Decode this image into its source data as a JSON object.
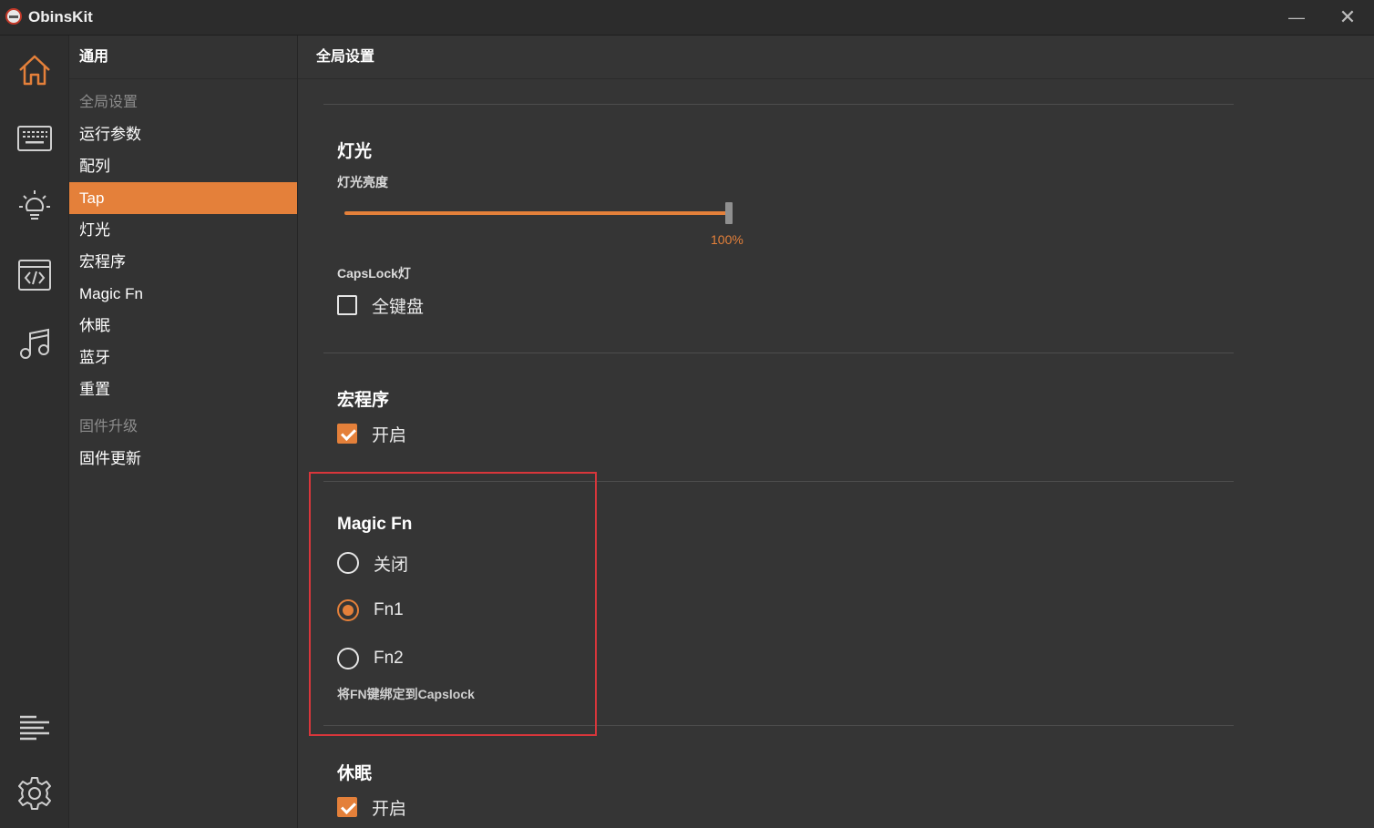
{
  "app": {
    "title": "ObinsKit"
  },
  "window": {
    "minimize": "—",
    "close": "✕"
  },
  "rail": {
    "icons": [
      "home-icon",
      "keyboard-icon",
      "light-bulb-icon",
      "code-icon",
      "music-icon",
      "list-icon",
      "gear-icon"
    ],
    "active_color": "#e4803a"
  },
  "nav": {
    "header": "通用",
    "section1": "全局设置",
    "items": [
      "运行参数",
      "配列",
      "Tap",
      "灯光",
      "宏程序",
      "Magic Fn",
      "休眠",
      "蓝牙",
      "重置"
    ],
    "active": "Tap",
    "section2": "固件升级",
    "items2": [
      "固件更新"
    ]
  },
  "main": {
    "header": "全局设置",
    "lighting": {
      "title": "灯光",
      "brightness_label": "灯光亮度",
      "brightness_value": "100%",
      "brightness_level": 100,
      "capslock_label": "CapsLock灯",
      "capslock_option": "全键盘",
      "capslock_checked": false
    },
    "macro": {
      "title": "宏程序",
      "enable_label": "开启",
      "enabled": true
    },
    "magic_fn": {
      "title": "Magic Fn",
      "options": [
        "关闭",
        "Fn1",
        "Fn2"
      ],
      "selected": "Fn1",
      "hint": "将FN键绑定到Capslock"
    },
    "sleep": {
      "title": "休眠",
      "enable_label": "开启",
      "enabled": true
    }
  },
  "colors": {
    "accent": "#e4803a",
    "highlight": "#d9363b",
    "background": "#353535"
  }
}
